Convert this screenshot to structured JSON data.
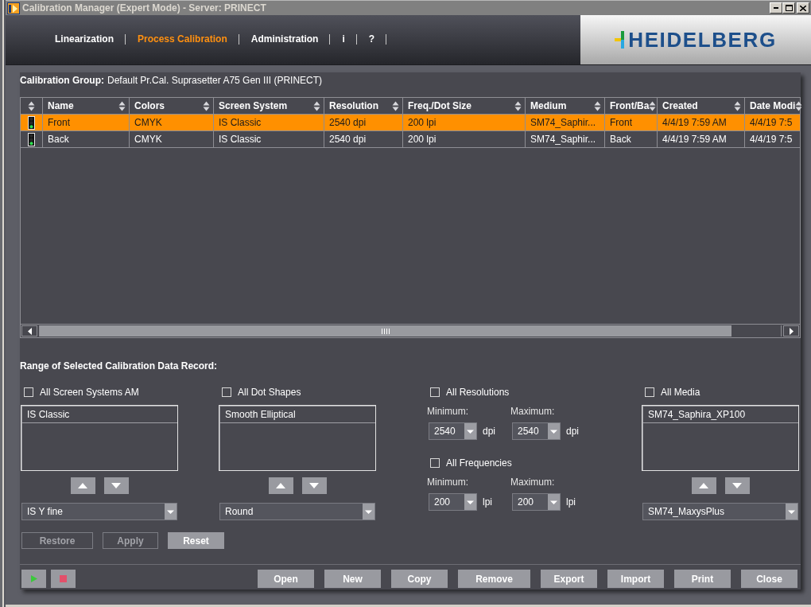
{
  "window": {
    "title": "Calibration Manager (Expert Mode) - Server: PRINECT"
  },
  "nav": {
    "tabs": [
      {
        "label": "Linearization",
        "selected": false
      },
      {
        "label": "Process Calibration",
        "selected": true
      },
      {
        "label": "Administration",
        "selected": false
      },
      {
        "label": "i",
        "selected": false
      },
      {
        "label": "?",
        "selected": false
      }
    ],
    "logo": "HEIDELBERG"
  },
  "calibration_group": {
    "label": "Calibration Group:",
    "value": "Default Pr.Cal. Suprasetter A75 Gen III (PRINECT)"
  },
  "table": {
    "columns": [
      "Name",
      "Colors",
      "Screen System",
      "Resolution",
      "Freq./Dot Size",
      "Medium",
      "Front/Ba",
      "Created",
      "Date Modi"
    ],
    "rows": [
      {
        "selected": true,
        "ready": true,
        "cells": [
          "Front",
          "CMYK",
          "IS Classic",
          "2540 dpi",
          "200 lpi",
          "SM74_Saphir...",
          "Front",
          "4/4/19 7:59 AM",
          "4/4/19 7:5"
        ]
      },
      {
        "selected": false,
        "ready": true,
        "cells": [
          "Back",
          "CMYK",
          "IS Classic",
          "2540 dpi",
          "200 lpi",
          "SM74_Saphir...",
          "Back",
          "4/4/19 7:59 AM",
          "4/4/19 7:5"
        ]
      }
    ]
  },
  "range": {
    "title": "Range of Selected Calibration Data Record:",
    "groups": [
      {
        "kind": "list",
        "checkbox": {
          "label": "All Screen Systems AM",
          "checked": false
        },
        "items": [
          "IS Classic"
        ],
        "dropdown": "IS Y fine"
      },
      {
        "kind": "list",
        "checkbox": {
          "label": "All Dot Shapes",
          "checked": false
        },
        "items": [
          "Smooth Elliptical"
        ],
        "dropdown": "Round"
      },
      {
        "kind": "limits",
        "sections": [
          {
            "checkbox": {
              "label": "All Resolutions",
              "checked": false
            },
            "minimum": {
              "label": "Minimum:",
              "value": "2540",
              "unit": "dpi"
            },
            "maximum": {
              "label": "Maximum:",
              "value": "2540",
              "unit": "dpi"
            }
          },
          {
            "checkbox": {
              "label": "All Frequencies",
              "checked": false
            },
            "minimum": {
              "label": "Minimum:",
              "value": "200",
              "unit": "lpi"
            },
            "maximum": {
              "label": "Maximum:",
              "value": "200",
              "unit": "lpi"
            }
          }
        ]
      },
      {
        "kind": "list",
        "checkbox": {
          "label": "All Media",
          "checked": false
        },
        "items": [
          "SM74_Saphira_XP100"
        ],
        "dropdown": "SM74_MaxysPlus"
      }
    ],
    "buttons": [
      {
        "label": "Restore",
        "disabled": true
      },
      {
        "label": "Apply",
        "disabled": true
      },
      {
        "label": "Reset",
        "disabled": false
      }
    ]
  },
  "footer": {
    "buttons": [
      "Open",
      "New",
      "Copy",
      "Remove",
      "Export",
      "Import",
      "Print",
      "Close"
    ]
  }
}
